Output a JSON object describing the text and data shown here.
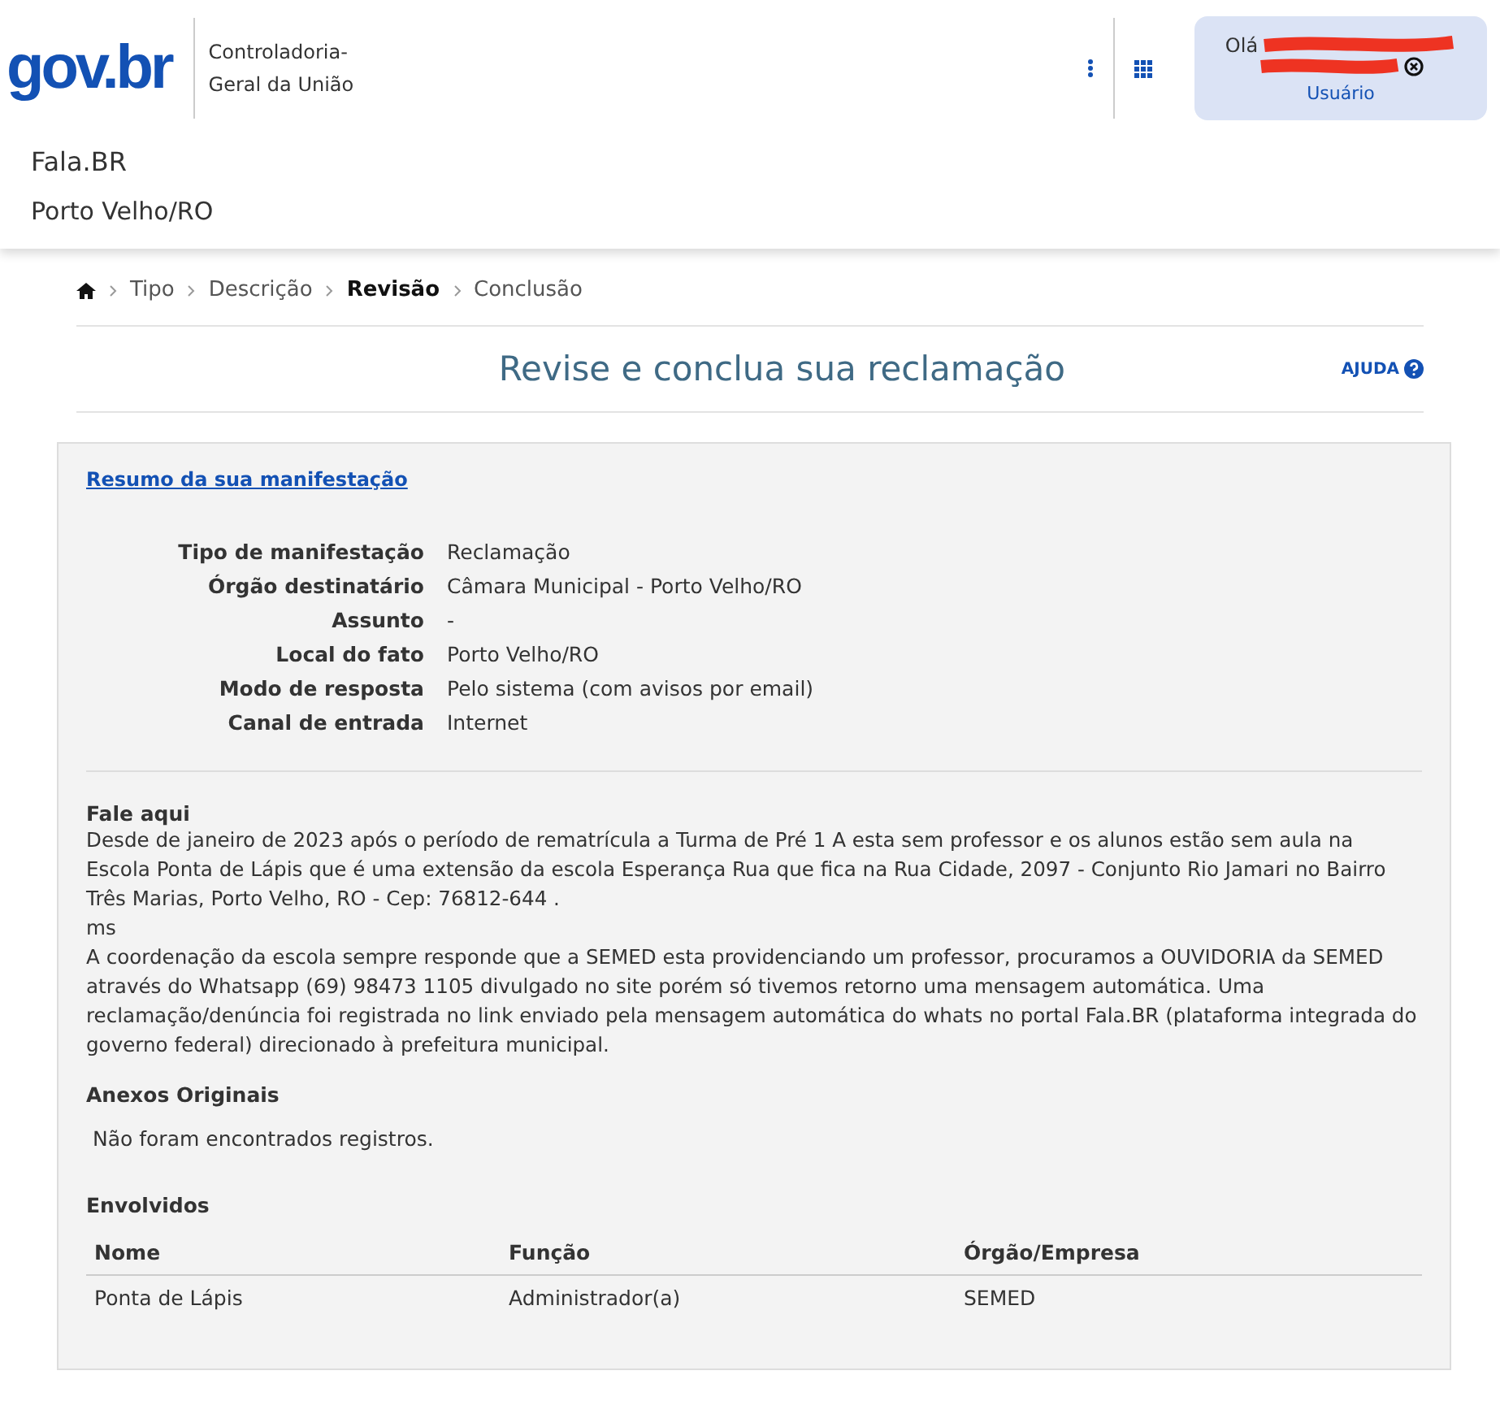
{
  "header": {
    "logo": "gov.br",
    "org_lines": [
      "Controladoria-",
      "Geral da União"
    ],
    "user": {
      "greeting": "Olá",
      "role": "Usuário"
    }
  },
  "app": {
    "name": "Fala.BR",
    "location": "Porto Velho/RO"
  },
  "breadcrumb": [
    {
      "label": "Tipo",
      "selected": false
    },
    {
      "label": "Descrição",
      "selected": false
    },
    {
      "label": "Revisão",
      "selected": true
    },
    {
      "label": "Conclusão",
      "selected": false
    }
  ],
  "title": "Revise e conclua sua reclamação",
  "help": "AJUDA",
  "summary_link": "Resumo da sua manifestação",
  "fields": [
    {
      "label": "Tipo de manifestação",
      "value": "Reclamação"
    },
    {
      "label": "Órgão destinatário",
      "value": "Câmara Municipal - Porto Velho/RO"
    },
    {
      "label": "Assunto",
      "value": "-"
    },
    {
      "label": "Local do fato",
      "value": "Porto Velho/RO"
    },
    {
      "label": "Modo de resposta",
      "value": "Pelo sistema (com avisos por email)"
    },
    {
      "label": "Canal de entrada",
      "value": "Internet"
    }
  ],
  "message": {
    "heading": "Fale aqui",
    "paragraphs": [
      "Desde de janeiro de 2023 após o período de rematrícula a Turma de Pré 1 A esta sem professor e os alunos estão sem aula na Escola Ponta de Lápis que é uma extensão da escola Esperança Rua que fica na Rua Cidade, 2097 -  Conjunto Rio Jamari no Bairro Três Marias, Porto Velho, RO - Cep: 76812-644 .",
      "ms",
      "A coordenação da escola sempre responde que a SEMED esta providenciando um professor, procuramos  a OUVIDORIA da SEMED através do Whatsapp (69) 98473 1105 divulgado no site porém só tivemos retorno uma mensagem automática. Uma reclamação/denúncia foi registrada no link enviado pela mensagem automática do whats no portal Fala.BR (plataforma integrada do governo federal) direcionado à prefeitura municipal."
    ]
  },
  "attachments": {
    "heading": "Anexos Originais",
    "empty": "Não foram encontrados registros."
  },
  "involved": {
    "heading": "Envolvidos",
    "columns": [
      "Nome",
      "Função",
      "Órgão/Empresa"
    ],
    "rows": [
      [
        "Ponta de Lápis",
        "Administrador(a)",
        "SEMED"
      ]
    ]
  }
}
